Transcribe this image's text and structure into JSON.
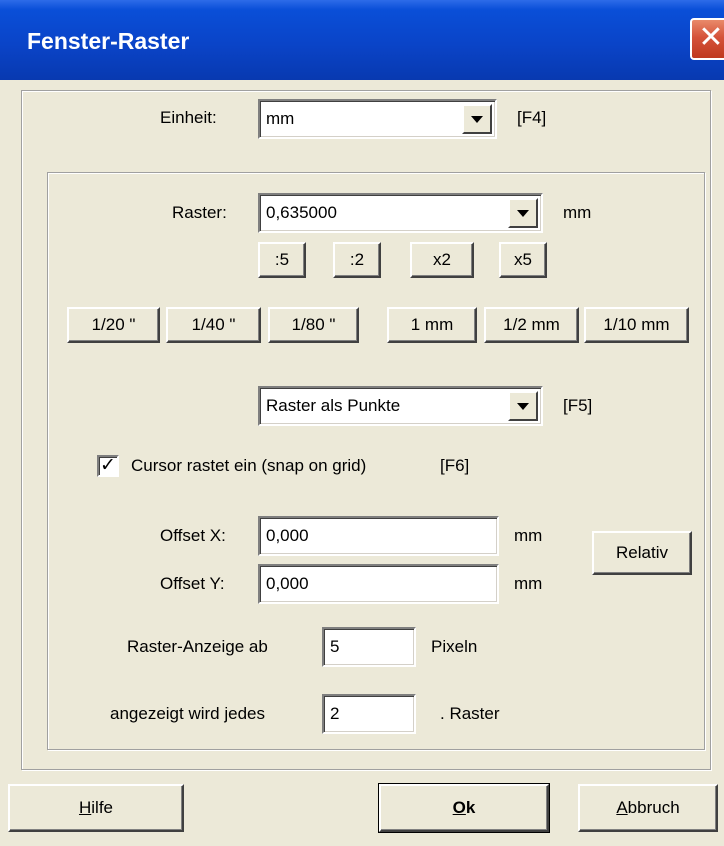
{
  "window": {
    "title": "Fenster-Raster",
    "close_glyph": "✕"
  },
  "einheit": {
    "label": "Einheit:",
    "value": "mm",
    "shortcut": "[F4]"
  },
  "raster": {
    "label": "Raster:",
    "value": "0,635000",
    "unit": "mm",
    "divide_buttons": [
      ":5",
      ":2",
      "x2",
      "x5"
    ],
    "presets": [
      "1/20 \"",
      "1/40 \"",
      "1/80 \"",
      "1 mm",
      "1/2 mm",
      "1/10 mm"
    ]
  },
  "display_mode": {
    "value": "Raster als Punkte",
    "shortcut": "[F5]"
  },
  "snap": {
    "checked": true,
    "check_glyph": "✓",
    "label": "Cursor rastet ein (snap on grid)",
    "shortcut": "[F6]"
  },
  "offset": {
    "x_label": "Offset X:",
    "x_value": "0,000",
    "x_unit": "mm",
    "y_label": "Offset Y:",
    "y_value": "0,000",
    "y_unit": "mm",
    "relativ_label": "Relativ"
  },
  "raster_anzeige": {
    "label": "Raster-Anzeige ab",
    "value": "5",
    "unit": "Pixeln"
  },
  "angezeigt": {
    "label": "angezeigt wird jedes",
    "value": "2",
    "suffix": ".  Raster"
  },
  "footer": {
    "hilfe": {
      "accel": "H",
      "rest": "ilfe"
    },
    "ok": {
      "accel": "O",
      "rest": "k"
    },
    "abbruch": {
      "accel": "A",
      "rest": "bbruch"
    }
  }
}
